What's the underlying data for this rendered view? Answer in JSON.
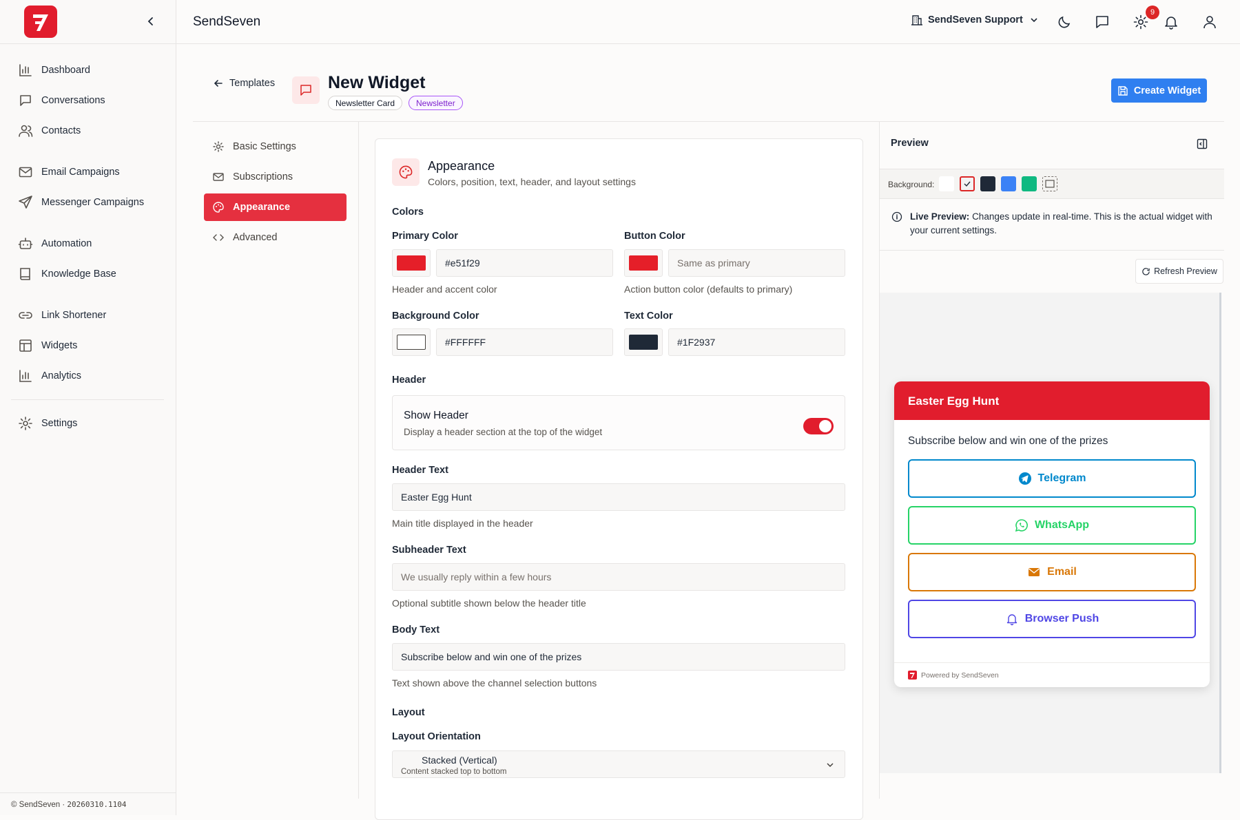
{
  "app": {
    "name": "SendSeven"
  },
  "sidebar": {
    "items": [
      {
        "label": "Dashboard",
        "icon": "bar-chart-icon"
      },
      {
        "label": "Conversations",
        "icon": "chat-icon"
      },
      {
        "label": "Contacts",
        "icon": "users-icon"
      },
      {
        "label": "Email Campaigns",
        "icon": "mail-icon"
      },
      {
        "label": "Messenger Campaigns",
        "icon": "send-icon"
      },
      {
        "label": "Automation",
        "icon": "bot-icon"
      },
      {
        "label": "Knowledge Base",
        "icon": "book-icon"
      },
      {
        "label": "Link Shortener",
        "icon": "link-icon"
      },
      {
        "label": "Widgets",
        "icon": "layout-icon"
      },
      {
        "label": "Analytics",
        "icon": "bar-chart-icon"
      },
      {
        "label": "Settings",
        "icon": "gear-icon"
      }
    ],
    "footer": {
      "copyright": "© SendSeven",
      "separator": "·",
      "version": "20260310.1104"
    }
  },
  "topbar": {
    "account": "SendSeven Support",
    "notifications_count": "9"
  },
  "page": {
    "back_label": "Templates",
    "title": "New Widget",
    "chips": [
      "Newsletter Card",
      "Newsletter"
    ],
    "create_button": "Create Widget"
  },
  "tabs": [
    {
      "label": "Basic Settings",
      "icon": "gear-icon",
      "active": false
    },
    {
      "label": "Subscriptions",
      "icon": "mail-icon",
      "active": false
    },
    {
      "label": "Appearance",
      "icon": "palette-icon",
      "active": true
    },
    {
      "label": "Advanced",
      "icon": "code-icon",
      "active": false
    }
  ],
  "appearance": {
    "title": "Appearance",
    "subtitle": "Colors, position, text, header, and layout settings",
    "colors_section": "Colors",
    "primary": {
      "label": "Primary Color",
      "value": "#e51f29",
      "help": "Header and accent color",
      "swatch": "#e51f29"
    },
    "button": {
      "label": "Button Color",
      "placeholder": "Same as primary",
      "help": "Action button color (defaults to primary)",
      "swatch": "#e51f29"
    },
    "background": {
      "label": "Background Color",
      "value": "#FFFFFF",
      "swatch": "#FFFFFF"
    },
    "text": {
      "label": "Text Color",
      "value": "#1F2937",
      "swatch": "#1F2937"
    },
    "header_section": "Header",
    "show_header": {
      "label": "Show Header",
      "desc": "Display a header section at the top of the widget",
      "enabled": true
    },
    "header_text": {
      "label": "Header Text",
      "value": "Easter Egg Hunt",
      "help": "Main title displayed in the header"
    },
    "subheader_text": {
      "label": "Subheader Text",
      "placeholder": "We usually reply within a few hours",
      "help": "Optional subtitle shown below the header title"
    },
    "body_text": {
      "label": "Body Text",
      "value": "Subscribe below and win one of the prizes",
      "help": "Text shown above the channel selection buttons"
    },
    "layout_section": "Layout",
    "orientation": {
      "label": "Layout Orientation",
      "value": "Stacked (Vertical)",
      "desc": "Content stacked top to bottom"
    }
  },
  "preview": {
    "title": "Preview",
    "background_label": "Background:",
    "backgrounds": [
      "#ffffff",
      "#f3f3f3",
      "#1f2937",
      "#3b82f6",
      "#10b981",
      "transparent"
    ],
    "info_bold": "Live Preview:",
    "info_text": "Changes update in real-time. This is the actual widget with your current settings.",
    "refresh": "Refresh Preview",
    "widget": {
      "header": "Easter Egg Hunt",
      "body": "Subscribe below and win one of the prizes",
      "buttons": [
        {
          "label": "Telegram",
          "color": "#0088cc"
        },
        {
          "label": "WhatsApp",
          "color": "#25d366"
        },
        {
          "label": "Email",
          "color": "#d97706"
        },
        {
          "label": "Browser Push",
          "color": "#4f46e5"
        }
      ],
      "footer": "Powered by SendSeven"
    }
  }
}
